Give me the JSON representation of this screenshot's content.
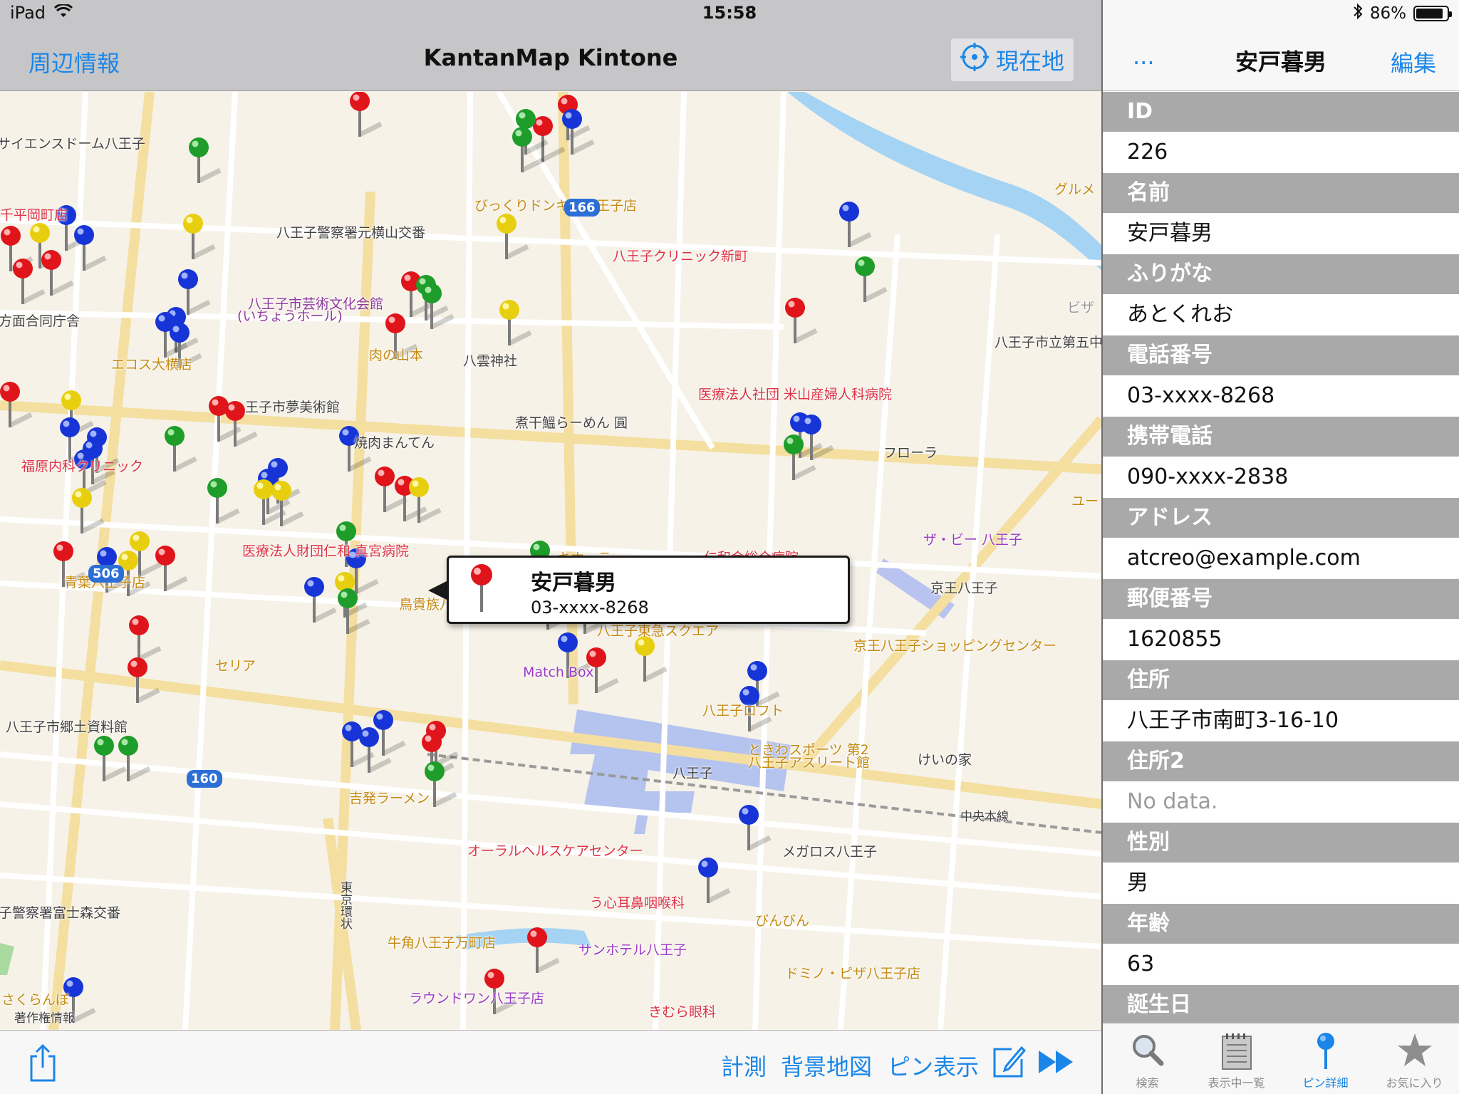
{
  "status": {
    "device": "iPad",
    "time": "15:58",
    "battery": "86%"
  },
  "nav_left": {
    "left_link": "周辺情報",
    "title": "KantanMap Kintone",
    "location_button": "現在地"
  },
  "callout": {
    "name": "安戸暮男",
    "phone": "03-xxxx-8268"
  },
  "toolbar": {
    "measure": "計測",
    "background_map": "背景地図",
    "pin_display": "ピン表示"
  },
  "nav_right": {
    "more": "...",
    "title": "安戸暮男",
    "edit": "編集"
  },
  "fields": [
    {
      "label": "ID",
      "value": "226"
    },
    {
      "label": "名前",
      "value": "安戸暮男"
    },
    {
      "label": "ふりがな",
      "value": "あとくれお"
    },
    {
      "label": "電話番号",
      "value": "03-xxxx-8268"
    },
    {
      "label": "携帯電話",
      "value": "090-xxxx-2838"
    },
    {
      "label": "アドレス",
      "value": "atcreo@example.com"
    },
    {
      "label": "郵便番号",
      "value": "1620855"
    },
    {
      "label": "住所",
      "value": "八王子市南町3-16-10"
    },
    {
      "label": "住所2",
      "value": "No data."
    },
    {
      "label": "性別",
      "value": "男"
    },
    {
      "label": "年齢",
      "value": "63"
    },
    {
      "label": "誕生日",
      "value": ""
    }
  ],
  "tabs": [
    {
      "label": "検索",
      "icon": "magnifier-icon",
      "active": false
    },
    {
      "label": "表示中一覧",
      "icon": "notepad-icon",
      "active": false
    },
    {
      "label": "ピン詳細",
      "icon": "pin-icon",
      "active": true
    },
    {
      "label": "お気に入り",
      "icon": "star-icon",
      "active": false
    }
  ],
  "map": {
    "labels": [
      "サイエンスドーム八王子",
      "千平岡町店",
      "方面合同庁舎",
      "エコス大横店",
      "八王子警察署元横山交番",
      "八王子市芸術文化会館",
      "(いちょうホール)",
      "肉の山本",
      "八雲神社",
      "びっくりドンキー八王子店",
      "八王子クリニック新町",
      "八王子市立第五中",
      "医療法人社団 米山産婦人科病院",
      "煮干鰮らーめん 圓",
      "フローラ",
      "王子市夢美術館",
      "焼肉まんてん",
      "福原内科クリニック",
      "医療法人財団仁和 真宮病院",
      "仁和会総合病院",
      "ザ・ビー 八王子",
      "京王八王子",
      "鳥貴族八王子北口店",
      "キホーテ",
      "八王子東急スクエア",
      "京王八王子ショッピングセンター",
      "セリア",
      "Match Box",
      "八王子ロフト",
      "ときわスポーツ 第2",
      "八王子アスリート館",
      "けいの家",
      "八王子",
      "八王子市郷土資料館",
      "吉発ラーメン",
      "中央本線",
      "オーラルヘルスケアセンター",
      "メガロス八王子",
      "う心耳鼻咽喉科",
      "びんびん",
      "子警察署富士森交番",
      "牛角八王子万町店",
      "サンホテル八王子",
      "ドミノ・ピザ八王子店",
      "ラウンドワン八王子店",
      "きむら眼科",
      "さくらんぼ",
      "著作権情報",
      "青葉八王子店",
      "グルメ",
      "ビザ",
      "ユー",
      "166",
      "506",
      "160",
      "東京環状"
    ]
  }
}
